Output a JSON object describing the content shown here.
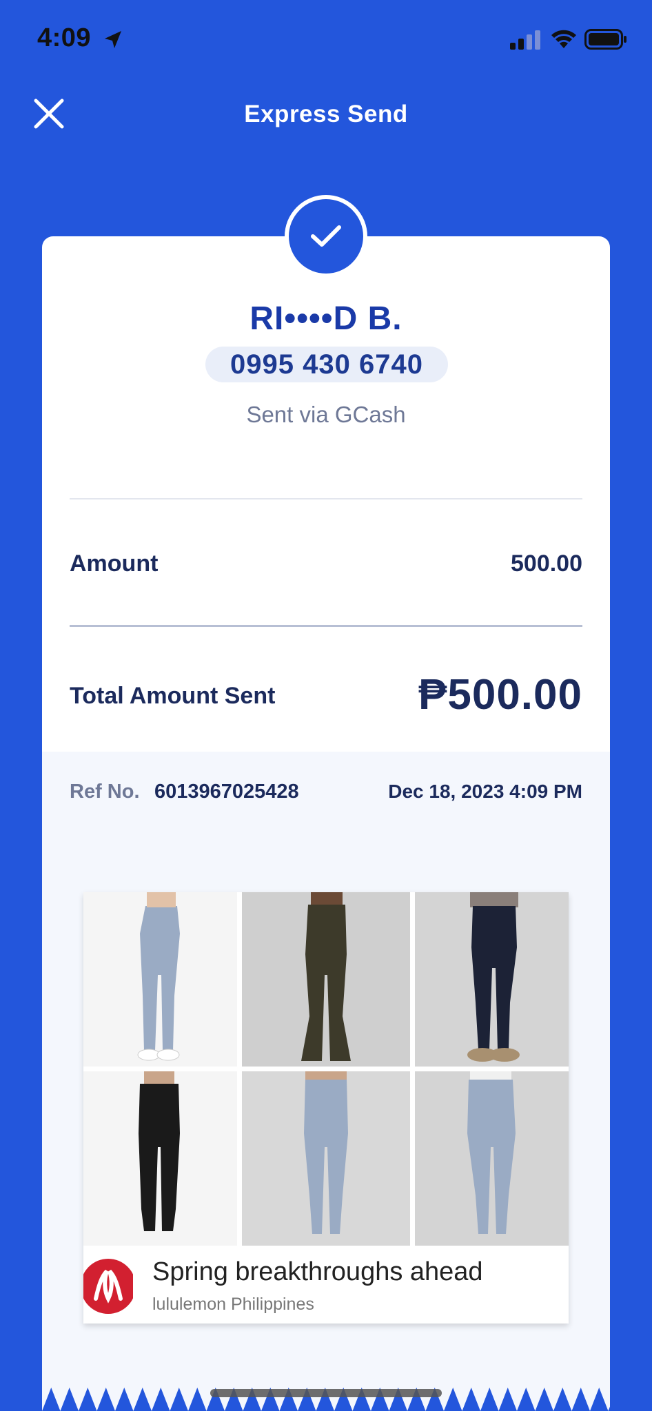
{
  "status_bar": {
    "time": "4:09",
    "icons": [
      "location-arrow-icon",
      "cellular-signal-icon",
      "wifi-icon",
      "battery-icon"
    ]
  },
  "header": {
    "title": "Express Send",
    "close_icon": "close-icon"
  },
  "receipt": {
    "status_icon": "checkmark-icon",
    "recipient_name": "RI••••D B.",
    "recipient_number": "0995 430 6740",
    "sent_via": "Sent via GCash",
    "amount_label": "Amount",
    "amount_value": "500.00",
    "total_label": "Total Amount Sent",
    "total_value": "₱500.00",
    "ref_label": "Ref No.",
    "ref_value": "6013967025428",
    "date": "Dec 18, 2023 4:09 PM"
  },
  "ad": {
    "headline": "Spring breakthroughs ahead",
    "advertiser": "lululemon Philippines",
    "info_icon": "ad-info-icon",
    "close_icon": "ad-close-icon",
    "products": [
      {
        "name": "product-tile-1",
        "color": "#9aabc4"
      },
      {
        "name": "product-tile-2",
        "color": "#3d3a2a"
      },
      {
        "name": "product-tile-3",
        "color": "#1c2236"
      },
      {
        "name": "product-tile-4",
        "color": "#1a1a1a"
      },
      {
        "name": "product-tile-5",
        "color": "#9aabc4"
      },
      {
        "name": "product-tile-6",
        "color": "#9aabc4"
      }
    ]
  },
  "colors": {
    "brand_blue": "#2356dc",
    "text_navy": "#1b2a5c",
    "muted": "#6e7896",
    "lululemon_red": "#d22030"
  }
}
